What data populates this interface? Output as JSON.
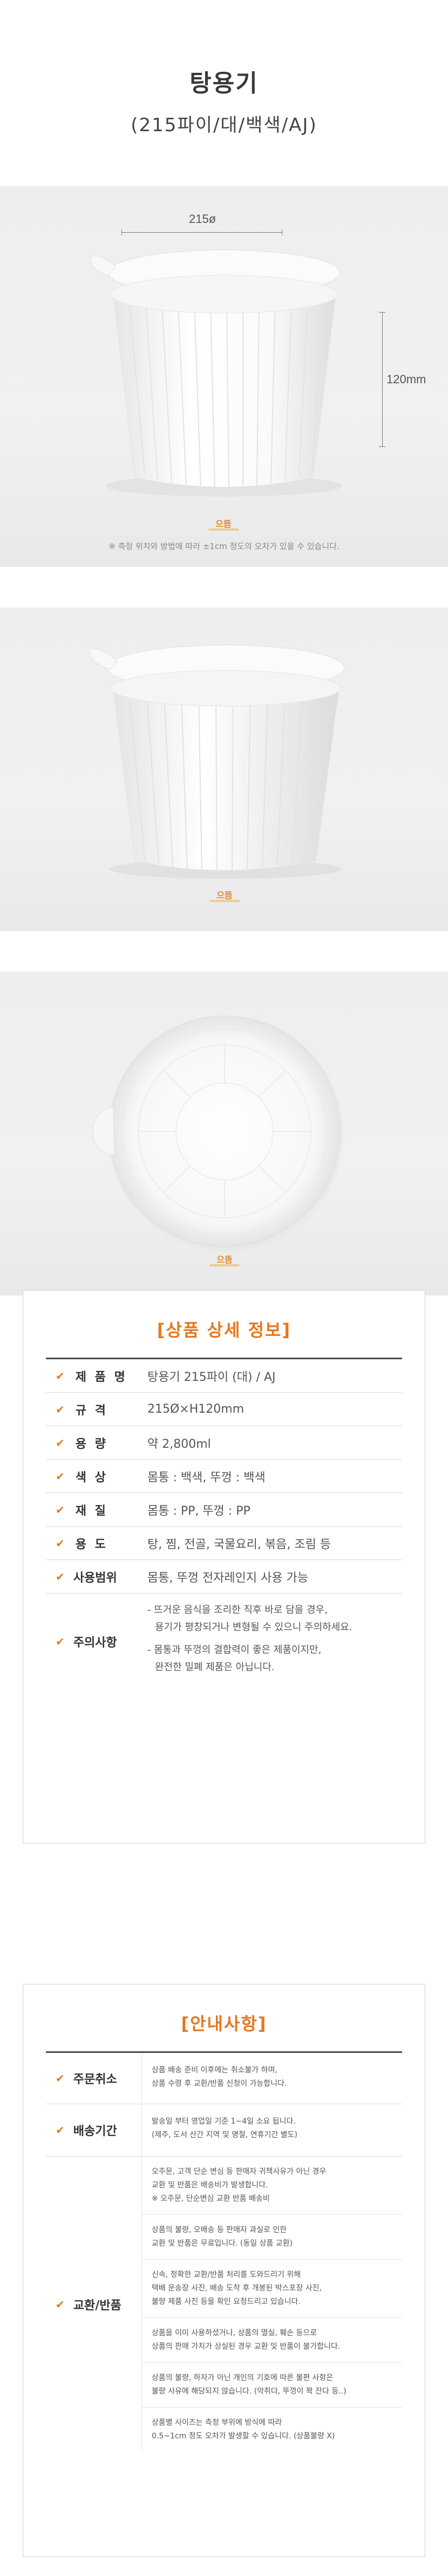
{
  "header": {
    "title": "탕용기",
    "subtitle": "(215파이/대/백색/AJ)"
  },
  "photo1": {
    "width_label": "215ø",
    "height_label": "120mm",
    "note": "※ 측정 위치와 방법에 따라 ±1cm 정도의 오차가 있을 수 있습니다."
  },
  "watermark": "으뜸",
  "spec": {
    "title": "[상품 상세 정보]",
    "rows": [
      {
        "key": "제 품 명",
        "value": "탕용기 215파이 (대) / AJ"
      },
      {
        "key": "규 격",
        "value": "215Ø×H120mm"
      },
      {
        "key": "용 량",
        "value": "약 2,800ml"
      },
      {
        "key": "색 상",
        "value": "몸통 : 백색,  뚜껑 : 백색"
      },
      {
        "key": "재 질",
        "value": "몸통 : PP,  뚜껑 : PP"
      },
      {
        "key": "용 도",
        "value": "탕, 찜, 전골, 국물요리, 볶음, 조림 등"
      },
      {
        "key": "사용범위",
        "value": "몸통, 뚜껑 전자레인지 사용 가능"
      }
    ],
    "caution_key": "주의사항",
    "caution_lines": [
      "- 뜨거운 음식을 조리한 직후 바로 담을 경우,",
      "  용기가 평창되거나 변형될 수 있으니 주의하세요.",
      "- 몸통과 뚜껑의 결합력이 좋은 제품이지만,",
      "  완전한 밀폐 제품은 아닙니다."
    ]
  },
  "guide": {
    "title": "[안내사항]",
    "order_cancel": {
      "key": "주문취소",
      "lines": [
        "상품 배송 준비 이후에는 취소불가 하며,",
        "상품 수령 후 교환/반품 신청이 가능합니다."
      ]
    },
    "delivery": {
      "key": "배송기간",
      "lines": [
        "발송일 부터 영업일 기준 1~4일 소요 됩니다.",
        "(제주, 도서 산간 지역 및 명절, 연휴기간 별도)"
      ]
    },
    "exchange": {
      "key": "교환/반품",
      "blocks": [
        [
          "오주문, 고객 단순 변심 등 판매자 귀책사유가 아닌 경우",
          "교환 및 반품은 배송비가 발생합니다.",
          "※ 오주문, 단순변심 교환 반품 배송비"
        ],
        [
          "상품의 불량, 오배송 등 판매자 과실로 인한",
          "교환 및 반품은 무료입니다. (동일 상품 교환)"
        ],
        [
          "신속, 정확한 교환/반품 처리를 도와드리기 위해",
          "택배 운송장 사진, 배송 도착 후 개봉된 박스포장 사진,",
          "불량 제품 사진 등을 확인 요청드리고 있습니다."
        ],
        [
          "상품을 이미 사용하셨거나, 상품의 멸실, 훼손 등으로",
          "상품의 판매 가치가 상실된 경우 교환 및 반품이 불가합니다."
        ],
        [
          "상품의 불량, 하자가 아닌 개인의 기호에 따른 불편 사항은",
          "불량 사유에 해당되지 않습니다. (악취다, 뚜껑이 꽉 잔다 등..)"
        ],
        [
          "상품별 사이즈는 측정 부위에 방식에 따라",
          "0.5~1cm 정도 오차가 발생할 수 있습니다. (상품불량 X)"
        ]
      ]
    }
  },
  "colors": {
    "accent": "#e5771e",
    "background_photo": "#eeeeee",
    "border": "#cfcfcf"
  }
}
